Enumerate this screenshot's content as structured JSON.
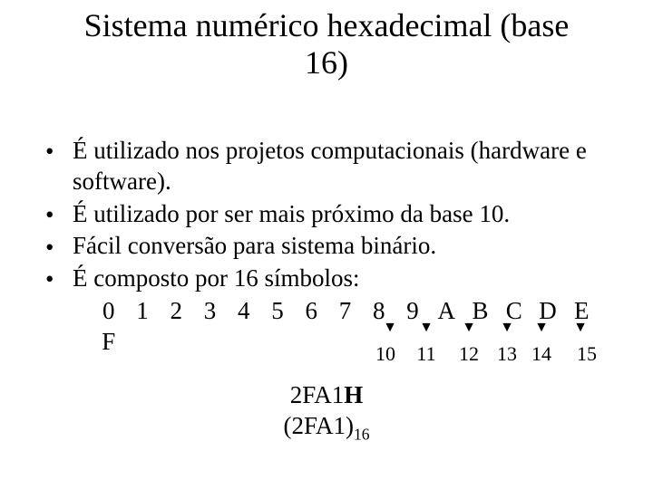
{
  "title_line1": "Sistema numérico hexadecimal (base",
  "title_line2": "16)",
  "bullets": [
    "É utilizado nos projetos computacionais (hardware e software).",
    "É utilizado por ser mais próximo da base 10.",
    "Fácil conversão para sistema binário.",
    "É composto por 16 símbolos:"
  ],
  "symbols": [
    "0",
    "1",
    "2",
    "3",
    "4",
    "5",
    "6",
    "7",
    "8",
    "9",
    "A",
    "B",
    "C",
    "D",
    "E",
    "F"
  ],
  "arrow_labels": [
    "10",
    "11",
    "12",
    "13",
    "14",
    "15"
  ],
  "example": {
    "line1_prefix": "2FA1",
    "line1_bold": "H",
    "line2_open": "(",
    "line2_value": "2FA1",
    "line2_close": ")",
    "line2_sub": "16"
  },
  "chart_data": {
    "type": "table",
    "title": "Hexadecimal digits A–F and their decimal equivalents",
    "categories": [
      "A",
      "B",
      "C",
      "D",
      "E",
      "F"
    ],
    "values": [
      10,
      11,
      12,
      13,
      14,
      15
    ]
  }
}
